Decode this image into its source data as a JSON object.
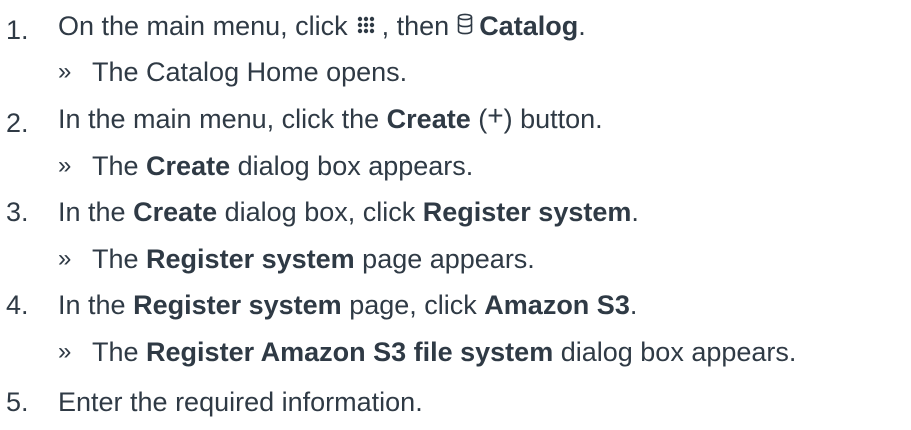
{
  "steps": [
    {
      "number": "1.",
      "parts": [
        "On the main menu, click",
        ", then",
        "Catalog",
        "."
      ],
      "icons": [
        "apps-grid-icon",
        "database-icon"
      ],
      "result": [
        "The Catalog Home opens."
      ]
    },
    {
      "number": "2.",
      "parts": [
        "In the main menu, click the",
        "Create",
        "(",
        "+",
        ") button."
      ],
      "icons": [
        "plus-icon"
      ],
      "result": [
        "The",
        "Create",
        "dialog box appears."
      ]
    },
    {
      "number": "3.",
      "parts": [
        "In the",
        "Create",
        "dialog box, click",
        "Register system",
        "."
      ],
      "result": [
        "The",
        "Register system",
        "page appears."
      ]
    },
    {
      "number": "4.",
      "parts": [
        "In the",
        "Register system",
        "page, click",
        "Amazon S3",
        "."
      ],
      "result": [
        "The",
        "Register Amazon S3 file system",
        "dialog box appears."
      ]
    },
    {
      "number": "5.",
      "parts": [
        "Enter the required information."
      ]
    }
  ],
  "result_marker": "»",
  "colors": {
    "text": "#2f3a45"
  }
}
